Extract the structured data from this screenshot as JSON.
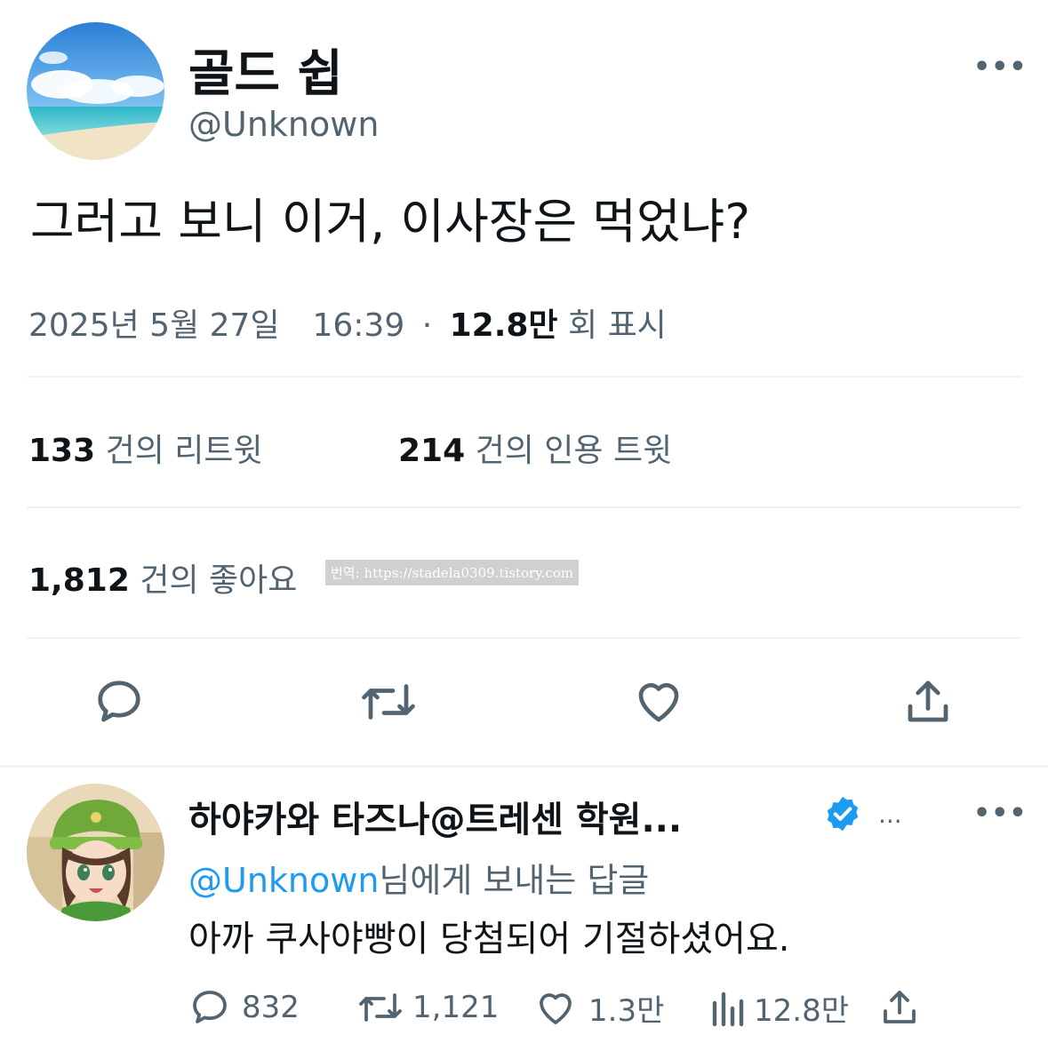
{
  "tweet": {
    "author_name": "골드 쉽",
    "handle": "@Unknown",
    "text": "그러고 보니 이거, 이사장은 먹었냐?",
    "date": "2025년 5월 27일",
    "time": "16:39",
    "separator": "·",
    "views_count": "12.8만",
    "views_label": "회 표시",
    "retweets_count": "133",
    "retweets_label": "건의 리트윗",
    "quotes_count": "214",
    "quotes_label": "건의 인용 트윗",
    "likes_count": "1,812",
    "likes_label": "건의 좋아요",
    "watermark": "번역: https://stadela0309.tistory.com",
    "more_label": "•••"
  },
  "reply": {
    "author_name": "하야카와 타즈나@트레센 학원...",
    "more_inline": "...",
    "more_label": "•••",
    "reply_to_handle": "@Unknown",
    "reply_to_suffix": "님에게 보내는 답글",
    "text": "아까 쿠사야빵이 당첨되어 기절하셨어요.",
    "replies": "832",
    "retweets": "1,121",
    "likes": "1.3만",
    "views": "12.8만"
  },
  "colors": {
    "text_primary": "#0f1419",
    "text_secondary": "#536471",
    "link": "#1d9bf0",
    "verified": "#1d9bf0",
    "divider": "#eff3f4"
  },
  "icons": [
    "reply-icon",
    "retweet-icon",
    "like-icon",
    "share-icon",
    "verified-badge-icon",
    "views-icon"
  ]
}
